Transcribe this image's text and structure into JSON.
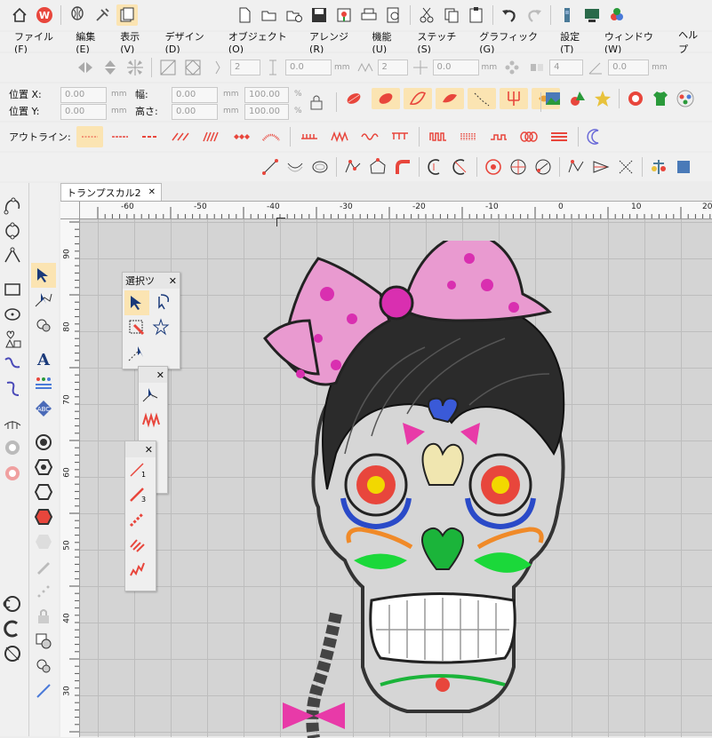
{
  "menu": [
    "ファイル(F)",
    "編集(E)",
    "表示(V)",
    "デザイン(D)",
    "オブジェクト(O)",
    "アレンジ(R)",
    "機能(U)",
    "ステッチ(S)",
    "グラフィック(G)",
    "設定(T)",
    "ウィンドウ(W)",
    "ヘルプ"
  ],
  "toolbar1": {
    "icons": [
      "home-icon",
      "wilcom-logo-icon",
      "balloon-icon",
      "tools-icon",
      "clipboard-icon",
      "new-icon",
      "open-icon",
      "open-recent-icon",
      "save-icon",
      "import-icon",
      "print-icon",
      "print-preview-icon",
      "cut-icon",
      "copy-icon",
      "paste-icon",
      "undo-icon",
      "redo-icon",
      "thread-icon",
      "design-view-icon",
      "colors-icon"
    ]
  },
  "toolbar2": {
    "spin1": "2",
    "spin2": "0.0",
    "unit1": "mm",
    "spin3": "2",
    "spin4": "0.0",
    "unit2": "mm",
    "spin5": "4",
    "spin6": "0.0",
    "unit3": "mm"
  },
  "position": {
    "x_label": "位置 X:",
    "y_label": "位置 Y:",
    "x_value": "0.00",
    "y_value": "0.00",
    "unit": "mm",
    "width_label": "幅:",
    "height_label": "高さ:",
    "width_value": "0.00",
    "height_value": "0.00",
    "width_pct": "100.00",
    "height_pct": "100.00",
    "pct": "%"
  },
  "outline": {
    "label": "アウトライン:"
  },
  "tab": {
    "title": "トランプスカル2",
    "close": "✕"
  },
  "ruler": {
    "h_ticks": [
      "-60",
      "-50",
      "-40",
      "-30",
      "-20",
      "-10",
      "0",
      "10",
      "20"
    ],
    "v_ticks": [
      "90",
      "80",
      "70",
      "60",
      "50",
      "40",
      "30"
    ]
  },
  "select_panel": {
    "title": "選択ツ",
    "close": "✕"
  },
  "panel2": {
    "close": "✕"
  },
  "panel3": {
    "close": "✕"
  },
  "colors": {
    "accent": "#e8463c",
    "highlight": "#fbe4b2",
    "canvas": "#d4d4d4",
    "grid": "#bdbdbd"
  }
}
